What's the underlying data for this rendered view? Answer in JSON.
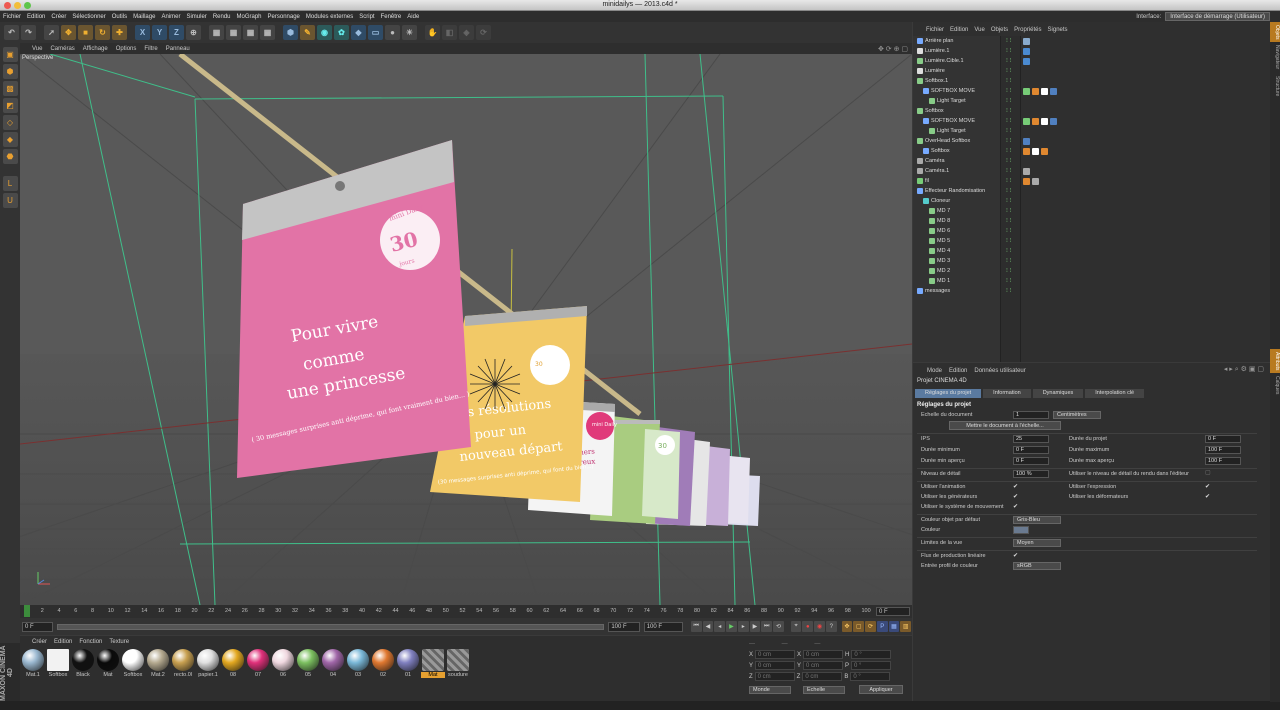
{
  "window": {
    "title": "minidailys — 2013.c4d *"
  },
  "menubar": [
    "Fichier",
    "Edition",
    "Créer",
    "Sélectionner",
    "Outils",
    "Maillage",
    "Animer",
    "Simuler",
    "Rendu",
    "MoGraph",
    "Personnage",
    "Modules externes",
    "Script",
    "Fenêtre",
    "Aide"
  ],
  "interface": {
    "label": "Interface:",
    "value": "Interface de démarrage (Utilisateur)"
  },
  "view_menu": [
    "Vue",
    "Caméras",
    "Affichage",
    "Options",
    "Filtre",
    "Panneau"
  ],
  "viewport": {
    "label": "Perspective"
  },
  "scene": {
    "card1_logo": "mini Daily",
    "card1_days": "30",
    "card1_days_word": "jours",
    "card1_lines": [
      "Pour vivre",
      "comme",
      "une princesse"
    ],
    "card1_sub": "( 30 messages surprises anti déprime, qui font vraiment du bien... )",
    "card2_lines": [
      "nes résolutions",
      "pour un",
      "nouveau départ"
    ],
    "card2_sub": "(30 messages surprises anti déprime, qui font du bien...)",
    "card3_lines": [
      "déjeuners",
      "amoureux"
    ],
    "card3_logo": "mini Daily",
    "card4_logo": "30"
  },
  "timeline": {
    "ticks": [
      "0",
      "2",
      "4",
      "6",
      "8",
      "10",
      "12",
      "14",
      "16",
      "18",
      "20",
      "22",
      "24",
      "26",
      "28",
      "30",
      "32",
      "34",
      "36",
      "38",
      "40",
      "42",
      "44",
      "46",
      "48",
      "50",
      "52",
      "54",
      "56",
      "58",
      "60",
      "62",
      "64",
      "66",
      "68",
      "70",
      "72",
      "74",
      "76",
      "78",
      "80",
      "82",
      "84",
      "86",
      "88",
      "90",
      "92",
      "94",
      "96",
      "98",
      "100"
    ],
    "end_frame": "0 F"
  },
  "playback": {
    "start": "0 F",
    "current": "100 F",
    "end": "100 F"
  },
  "materials": {
    "menu": [
      "Créer",
      "Edition",
      "Fonction",
      "Texture"
    ],
    "items": [
      {
        "name": "Mat.1",
        "color": "#9ab8d0"
      },
      {
        "name": "Softbox",
        "color": "#f2f2f2"
      },
      {
        "name": "Black",
        "color": "#111111"
      },
      {
        "name": "Mat",
        "color": "#0a0a0a"
      },
      {
        "name": "Softbox",
        "color": "#ffffff"
      },
      {
        "name": "Mat.2",
        "color": "#b5aa90"
      },
      {
        "name": "recto.0l",
        "color": "#c8a050"
      },
      {
        "name": "papier.1",
        "color": "#e0e0e0"
      },
      {
        "name": "08",
        "color": "#e3a820"
      },
      {
        "name": "07",
        "color": "#e0307a"
      },
      {
        "name": "06",
        "color": "#f0d8e0"
      },
      {
        "name": "05",
        "color": "#7cc060"
      },
      {
        "name": "04",
        "color": "#a066a8"
      },
      {
        "name": "03",
        "color": "#7ab8d8"
      },
      {
        "name": "02",
        "color": "#e07830"
      },
      {
        "name": "01",
        "color": "#8080c0"
      },
      {
        "name": "Mat",
        "color": "#888888"
      },
      {
        "name": "soudure",
        "color": "#777777"
      }
    ]
  },
  "coords": {
    "rows": [
      {
        "a": "X",
        "av": "0 cm",
        "b": "X",
        "bv": "0 cm",
        "c": "H",
        "cv": "0 °"
      },
      {
        "a": "Y",
        "av": "0 cm",
        "b": "Y",
        "bv": "0 cm",
        "c": "P",
        "cv": "0 °"
      },
      {
        "a": "Z",
        "av": "0 cm",
        "b": "Z",
        "bv": "0 cm",
        "c": "B",
        "cv": "0 °"
      }
    ],
    "mode": "Monde",
    "scale": "Echelle",
    "apply": "Appliquer"
  },
  "brand": "MAXON CINEMA 4D",
  "objects": {
    "menu": [
      "Fichier",
      "Edition",
      "Vue",
      "Objets",
      "Propriétés",
      "Signets"
    ],
    "items": [
      {
        "name": "Arrière plan",
        "indent": 0,
        "color": "#7af"
      },
      {
        "name": "Lumière.1",
        "indent": 0,
        "color": "#ddd"
      },
      {
        "name": "Lumière.Cible.1",
        "indent": 0,
        "color": "#8c8"
      },
      {
        "name": "Lumière",
        "indent": 0,
        "color": "#ddd"
      },
      {
        "name": "Softbox.1",
        "indent": 0,
        "color": "#8c8"
      },
      {
        "name": "SOFTBOX MOVE",
        "indent": 1,
        "color": "#7af"
      },
      {
        "name": "Light Target",
        "indent": 2,
        "color": "#8c8"
      },
      {
        "name": "Softbox",
        "indent": 0,
        "color": "#8c8"
      },
      {
        "name": "SOFTBOX MOVE",
        "indent": 1,
        "color": "#7af"
      },
      {
        "name": "Light Target",
        "indent": 2,
        "color": "#8c8"
      },
      {
        "name": "OverHead Softbox",
        "indent": 0,
        "color": "#8c8"
      },
      {
        "name": "Softbox",
        "indent": 1,
        "color": "#7af"
      },
      {
        "name": "Caméra",
        "indent": 0,
        "color": "#aaa"
      },
      {
        "name": "Caméra.1",
        "indent": 0,
        "color": "#aaa"
      },
      {
        "name": "fil",
        "indent": 0,
        "color": "#7c7"
      },
      {
        "name": "Effecteur Randomisation",
        "indent": 0,
        "color": "#7af"
      },
      {
        "name": "Cloneur",
        "indent": 1,
        "color": "#5cc"
      },
      {
        "name": "MD 7",
        "indent": 2,
        "color": "#8c8"
      },
      {
        "name": "MD 8",
        "indent": 2,
        "color": "#8c8"
      },
      {
        "name": "MD 6",
        "indent": 2,
        "color": "#8c8"
      },
      {
        "name": "MD 5",
        "indent": 2,
        "color": "#8c8"
      },
      {
        "name": "MD 4",
        "indent": 2,
        "color": "#8c8"
      },
      {
        "name": "MD 3",
        "indent": 2,
        "color": "#8c8"
      },
      {
        "name": "MD 2",
        "indent": 2,
        "color": "#8c8"
      },
      {
        "name": "MD 1",
        "indent": 2,
        "color": "#8c8"
      },
      {
        "name": "messages",
        "indent": 0,
        "color": "#7af"
      }
    ]
  },
  "right_tabs_top": [
    "Objets",
    "Navigateur",
    "Structure"
  ],
  "right_tabs_bottom": [
    "Attributs",
    "Calques"
  ],
  "attributes": {
    "menu": [
      "Mode",
      "Edition",
      "Données utilisateur"
    ],
    "title": "Projet CINEMA 4D",
    "tabs": [
      "Réglages du projet",
      "Information",
      "Dynamiques",
      "Interpolation clé"
    ],
    "section": "Réglages du projet",
    "doc_scale_label": "Echelle du document",
    "doc_scale_value": "1",
    "doc_scale_unit": "Centimètres",
    "scale_button": "Mettre le document à l'échelle...",
    "ips_label": "IPS",
    "ips_value": "25",
    "duree_projet_label": "Durée du projet",
    "duree_projet_value": "0 F",
    "duree_min_label": "Durée minimum",
    "duree_min_value": "0 F",
    "duree_max_label": "Durée maximum",
    "duree_max_value": "100 F",
    "duree_min_apercu_label": "Durée min aperçu",
    "duree_min_apercu_value": "0 F",
    "duree_max_apercu_label": "Durée max aperçu",
    "duree_max_apercu_value": "100 F",
    "niveau_label": "Niveau de détail",
    "niveau_value": "100 %",
    "niveau_rendu_label": "Utiliser le niveau de détail du rendu dans l'éditeur",
    "anim_label": "Utiliser l'animation",
    "expr_label": "Utiliser l'expression",
    "gen_label": "Utiliser les générateurs",
    "def_label": "Utiliser les déformateurs",
    "mvt_label": "Utiliser le système de mouvement",
    "couleur_obj_label": "Couleur objet par défaut",
    "couleur_obj_value": "Gris-Bleu",
    "couleur_label": "Couleur",
    "limites_label": "Limites de la vue",
    "limites_value": "Moyen",
    "flux_label": "Flux de production linéaire",
    "profil_label": "Entrée profil de couleur",
    "profil_value": "sRGB"
  }
}
